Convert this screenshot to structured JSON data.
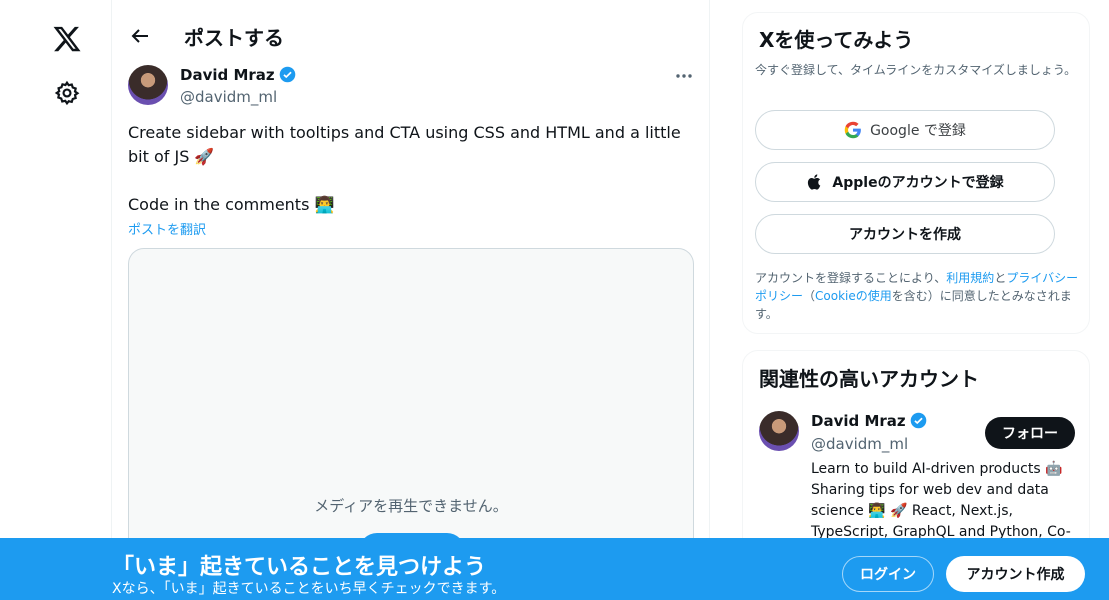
{
  "nav": {
    "logo_icon": "x-logo-icon",
    "settings_icon": "gear-icon"
  },
  "header": {
    "title": "ポストする"
  },
  "post": {
    "author_name": "David Mraz",
    "author_handle": "@davidm_ml",
    "text_line1": "Create sidebar with tooltips and CTA using CSS and HTML and a little bit of JS 🚀",
    "text_line2": "Code in the comments 👨‍💻",
    "translate_link": "ポストを翻訳",
    "media_message": "メディアを再生できません。"
  },
  "signup": {
    "title": "Xを使ってみよう",
    "subtitle": "今すぐ登録して、タイムラインをカスタマイズしましょう。",
    "google_label": "Google で登録",
    "apple_label": "Appleのアカウントで登録",
    "create_label": "アカウントを作成",
    "terms_prefix": "アカウントを登録することにより、",
    "terms_link": "利用規約",
    "terms_and": "と",
    "privacy_link": "プライバシーポリシー",
    "terms_open": "（",
    "cookie_link": "Cookieの使用",
    "terms_suffix": "を含む）に同意したとみなされます。"
  },
  "relevant": {
    "title": "関連性の高いアカウント",
    "name": "David Mraz",
    "handle": "@davidm_ml",
    "follow_label": "フォロー",
    "bio": "Learn to build AI-driven products 🤖 Sharing tips for web dev and data science 👨‍💻 🚀 React, Next.js, TypeScript, GraphQL and Python, Co-"
  },
  "banner": {
    "title": "「いま」起きていることを見つけよう",
    "subtitle": "Xなら、「いま」起きていることをいち早くチェックできます。",
    "login_label": "ログイン",
    "create_label": "アカウント作成"
  },
  "colors": {
    "accent": "#1d9bf0",
    "text": "#0f1419",
    "muted": "#536471"
  }
}
